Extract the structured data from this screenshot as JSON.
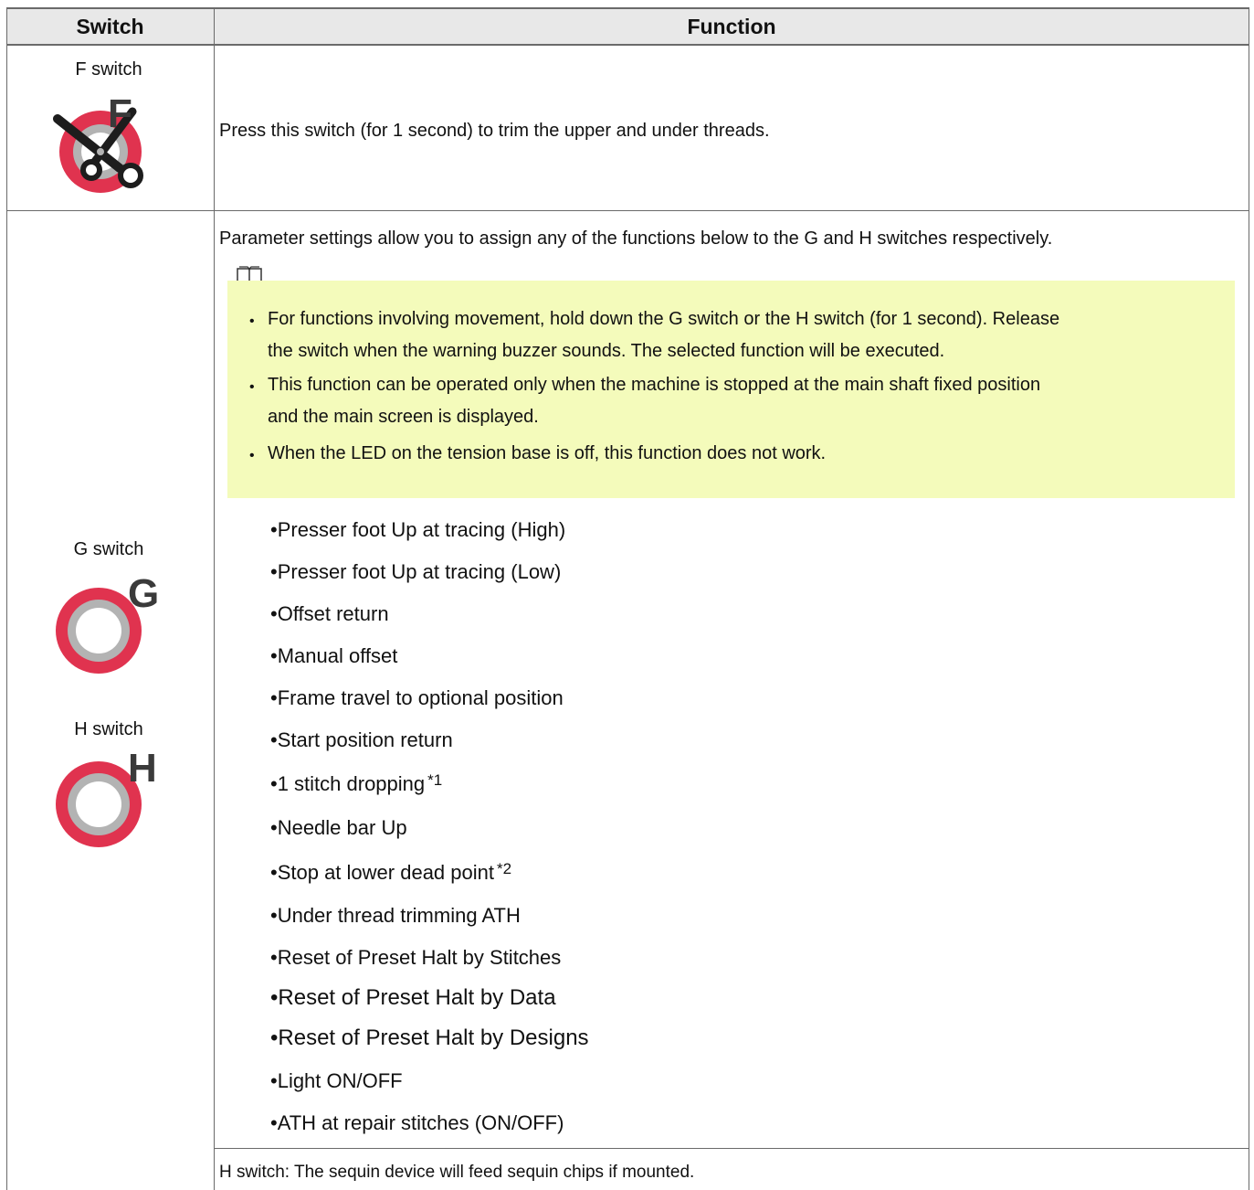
{
  "table": {
    "headers": {
      "switch": "Switch",
      "function": "Function"
    },
    "f_row": {
      "switch_label": "F switch",
      "icon": "scissors-icon",
      "icon_letter": "F",
      "function_text": "Press this switch (for 1 second) to trim the upper and under threads."
    },
    "gh_row": {
      "g_label": "G switch",
      "g_letter": "G",
      "h_label": "H switch",
      "h_letter": "H",
      "intro": "Parameter settings allow you to assign any of the functions below to the G and H switches respectively.",
      "note_icon": "book-icon",
      "notes": [
        "For functions involving movement, hold down the G switch or the H switch (for 1 second). Release",
        "the switch when the warning buzzer sounds. The selected function will be executed.",
        "This function can be operated only when the machine is stopped at the main shaft fixed position",
        "and the main screen is displayed.",
        "When the LED on the tension base is off, this function does not work."
      ],
      "functions": [
        {
          "text": "Presser foot Up at tracing (High)",
          "sup": ""
        },
        {
          "text": "Presser foot Up at tracing (Low)",
          "sup": ""
        },
        {
          "text": "Offset return",
          "sup": ""
        },
        {
          "text": "Manual offset",
          "sup": ""
        },
        {
          "text": "Frame travel to optional position",
          "sup": ""
        },
        {
          "text": "Start position return",
          "sup": ""
        },
        {
          "text": "1 stitch dropping",
          "sup": "*1"
        },
        {
          "text": "Needle bar Up",
          "sup": ""
        },
        {
          "text": "Stop at lower dead point",
          "sup": "*2"
        },
        {
          "text": "Under thread trimming ATH",
          "sup": ""
        },
        {
          "text": "Reset of Preset Halt by Stitches",
          "sup": ""
        },
        {
          "text": "Reset of Preset Halt by Data",
          "sup": ""
        },
        {
          "text": "Reset of Preset Halt by Designs",
          "sup": ""
        },
        {
          "text": "Light ON/OFF",
          "sup": ""
        },
        {
          "text": "ATH at repair stitches (ON/OFF)",
          "sup": ""
        }
      ],
      "bullet": "•",
      "footer": "H switch: The sequin device will feed sequin chips if mounted."
    },
    "colors": {
      "ring_red": "#e0334f",
      "ring_gray": "#b3b3b3",
      "note_bg": "#f4fbbb",
      "header_bg": "#e8e8e8"
    }
  }
}
